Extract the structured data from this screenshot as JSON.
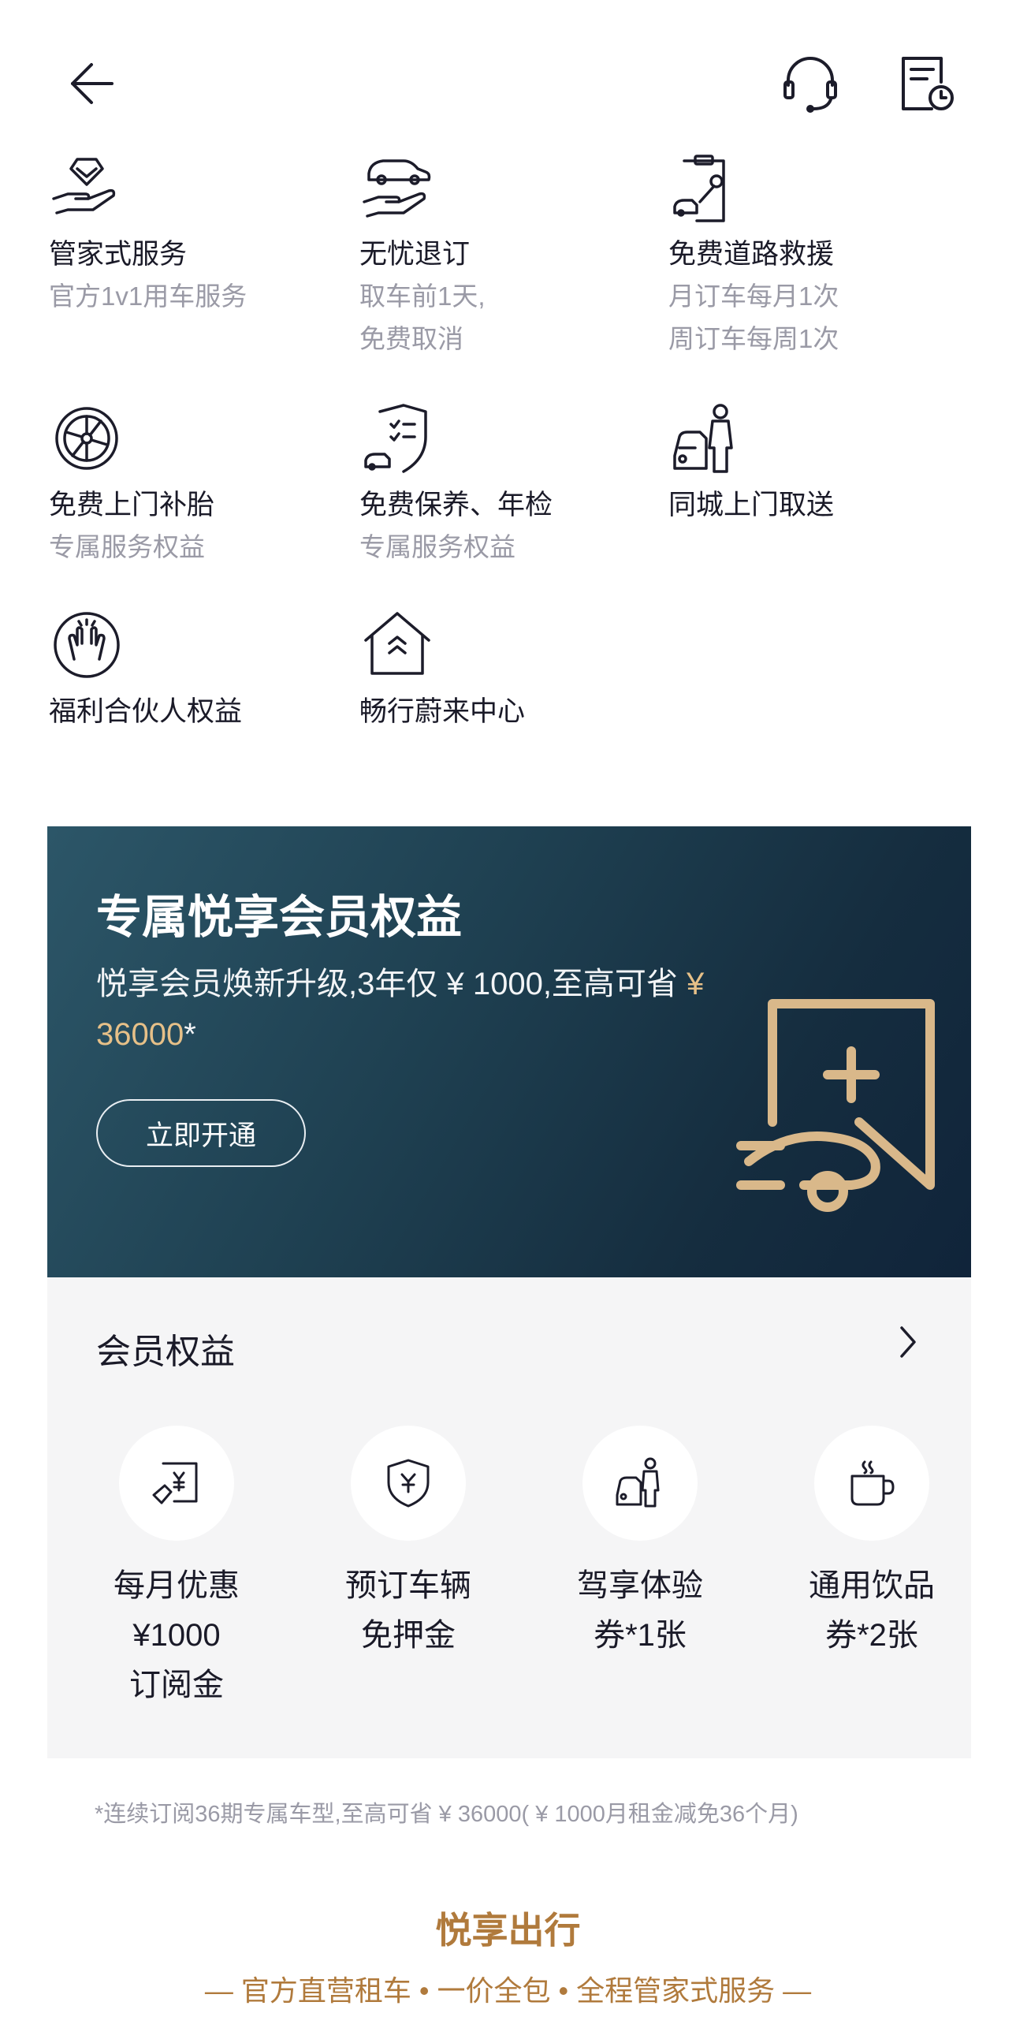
{
  "header": {
    "back_icon": "arrow-left-icon",
    "support_icon": "headset-icon",
    "orders_icon": "document-clock-icon"
  },
  "services": [
    {
      "icon": "diamond-hand-icon",
      "title": "管家式服务",
      "sub": "官方1v1用车服务"
    },
    {
      "icon": "car-hand-icon",
      "title": "无忧退订",
      "sub": "取车前1天,\n免费取消"
    },
    {
      "icon": "clipboard-wrench-icon",
      "title": "免费道路救援",
      "sub": "月订车每月1次\n周订车每周1次"
    },
    {
      "icon": "tire-icon",
      "title": "免费上门补胎",
      "sub": "专属服务权益"
    },
    {
      "icon": "shield-checklist-icon",
      "title": "免费保养、年检",
      "sub": "专属服务权益"
    },
    {
      "icon": "car-person-icon",
      "title": "同城上门取送",
      "sub": ""
    },
    {
      "icon": "high-five-icon",
      "title": "福利合伙人权益",
      "sub": ""
    },
    {
      "icon": "house-chevron-icon",
      "title": "畅行蔚来中心",
      "sub": ""
    }
  ],
  "banner": {
    "title": "专属悦享会员权益",
    "desc_before": "悦享会员焕新升级,3年仅 ¥ 1000,至高可省 ",
    "desc_highlight": "¥ 36000",
    "desc_after": "*",
    "button": "立即开通",
    "art_icon": "car-plus-card-icon",
    "highlight_color": "#e6c088"
  },
  "member": {
    "title": "会员权益",
    "arrow_icon": "chevron-right-icon",
    "benefits": [
      {
        "icon": "yen-card-icon",
        "text": "每月优惠\n¥1000\n订阅金"
      },
      {
        "icon": "yen-shield-icon",
        "text": "预订车辆\n免押金"
      },
      {
        "icon": "driver-car-icon",
        "text": "驾享体验\n券*1张"
      },
      {
        "icon": "coffee-cup-icon",
        "text": "通用饮品\n券*2张"
      }
    ]
  },
  "footnote": "*连续订阅36期专属车型,至高可省 ¥ 36000( ¥ 1000月租金减免36个月)",
  "brand": "悦享出行",
  "tagline": "— 官方直营租车 • 一价全包 • 全程管家式服务 —",
  "colors": {
    "accent_gold": "#b07a3c",
    "icon_dark": "#1c1c2a",
    "muted_text": "#9a9aa6"
  }
}
